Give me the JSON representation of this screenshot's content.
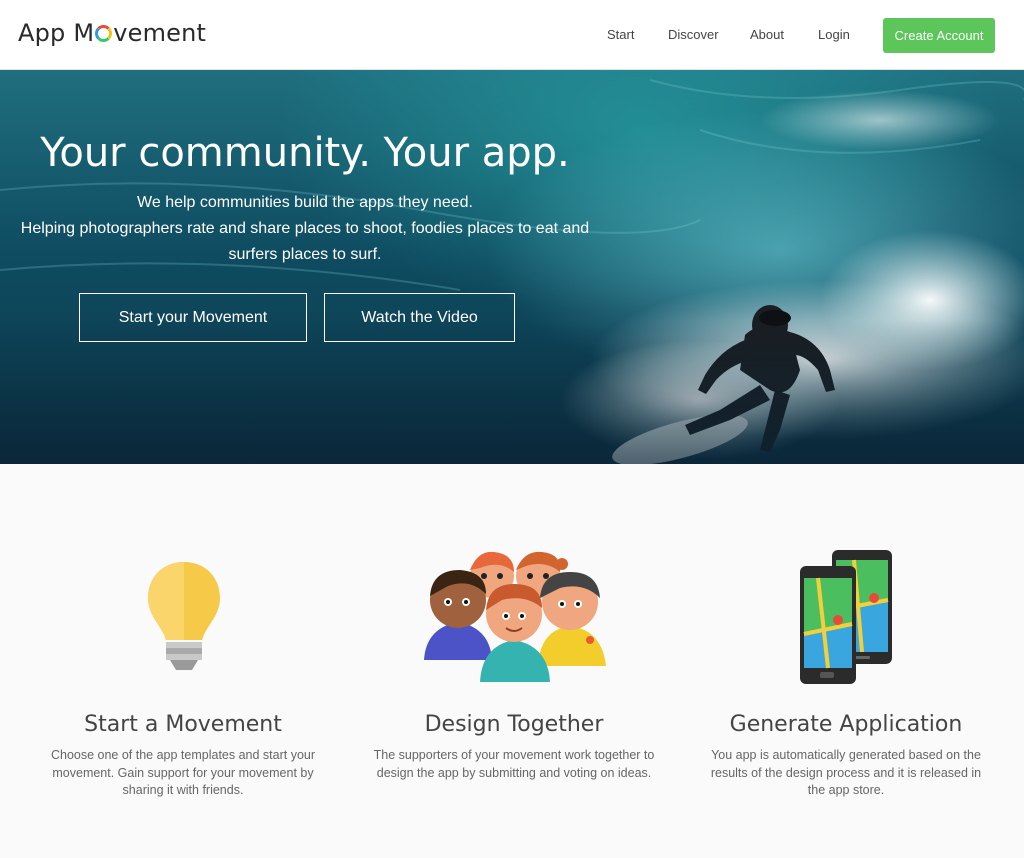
{
  "nav": {
    "logo_pre": "App M",
    "logo_post": "vement",
    "links": [
      "Start",
      "Discover",
      "About",
      "Login"
    ],
    "cta": "Create Account"
  },
  "hero": {
    "title": "Your community. Your app.",
    "line1": "We help communities build the apps they need.",
    "line2": "Helping photographers rate and share places to shoot, foodies places to eat and",
    "line3": "surfers places to surf.",
    "btn_start": "Start your Movement",
    "btn_video": "Watch the Video"
  },
  "features": [
    {
      "title": "Start a Movement",
      "desc": "Choose one of the app templates and start your movement. Gain support for your movement by sharing it with friends.",
      "icon": "lightbulb-icon"
    },
    {
      "title": "Design Together",
      "desc": "The supporters of your movement work together to design the app by submitting and voting on ideas.",
      "icon": "people-group-icon"
    },
    {
      "title": "Generate Application",
      "desc": "You app is automatically generated based on the results of the design process and it is released in the app store.",
      "icon": "phones-map-icon"
    }
  ],
  "colors": {
    "cta": "#5cc65a",
    "text": "#444444"
  }
}
